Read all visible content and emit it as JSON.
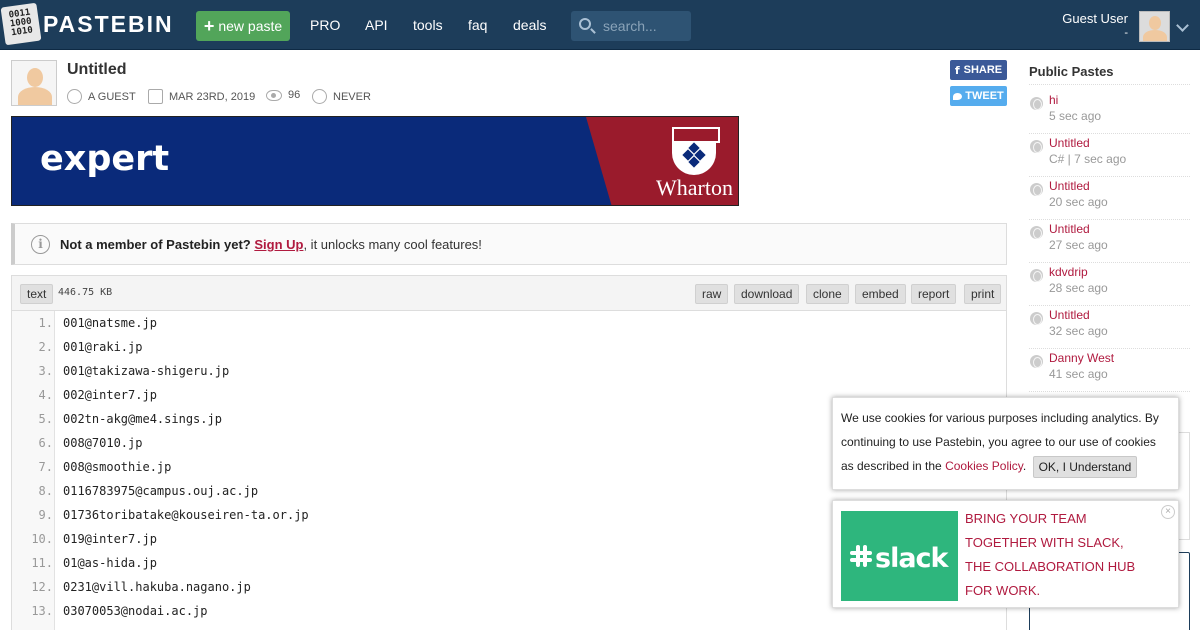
{
  "header": {
    "logo_glyphs": [
      "0011",
      "1000",
      "1010"
    ],
    "brand": "PASTEBIN",
    "new_paste": "new paste",
    "nav": [
      "PRO",
      "API",
      "tools",
      "faq",
      "deals"
    ],
    "search_placeholder": "search...",
    "user_name": "Guest User",
    "user_sub": "-"
  },
  "paste": {
    "title": "Untitled",
    "author": "A GUEST",
    "date": "MAR 23RD, 2019",
    "views": "96",
    "expires": "NEVER",
    "share_label": "SHARE",
    "tweet_label": "TWEET"
  },
  "ad": {
    "headline": "expert",
    "brand": "Wharton"
  },
  "notice": {
    "lead": "Not a member of Pastebin yet?",
    "link": "Sign Up",
    "rest": ", it unlocks many cool features!"
  },
  "codebox": {
    "syntax": "text",
    "size": "446.75 KB",
    "actions": [
      "raw",
      "download",
      "clone",
      "embed",
      "report",
      "print"
    ],
    "lines": [
      {
        "num": "1.",
        "text": "001@natsme.jp"
      },
      {
        "num": "2.",
        "text": "001@raki.jp"
      },
      {
        "num": "3.",
        "text": "001@takizawa-shigeru.jp"
      },
      {
        "num": "4.",
        "text": "002@inter7.jp"
      },
      {
        "num": "5.",
        "text": "002tn-akg@me4.sings.jp"
      },
      {
        "num": "6.",
        "text": "008@7010.jp"
      },
      {
        "num": "7.",
        "text": "008@smoothie.jp"
      },
      {
        "num": "8.",
        "text": "0116783975@campus.ouj.ac.jp"
      },
      {
        "num": "9.",
        "text": "01736toribatake@kouseiren-ta.or.jp"
      },
      {
        "num": "10.",
        "text": "019@inter7.jp"
      },
      {
        "num": "11.",
        "text": "01@as-hida.jp"
      },
      {
        "num": "12.",
        "text": "0231@vill.hakuba.nagano.jp"
      },
      {
        "num": "13.",
        "text": "03070053@nodai.ac.jp"
      }
    ]
  },
  "sidebar": {
    "title": "Public Pastes",
    "items": [
      {
        "title": "hi",
        "sub": "5 sec ago"
      },
      {
        "title": "Untitled",
        "sub": "C# | 7 sec ago"
      },
      {
        "title": "Untitled",
        "sub": "20 sec ago"
      },
      {
        "title": "Untitled",
        "sub": "27 sec ago"
      },
      {
        "title": "kdvdrip",
        "sub": "28 sec ago"
      },
      {
        "title": "Untitled",
        "sub": "32 sec ago"
      },
      {
        "title": "Danny West",
        "sub": "41 sec ago"
      }
    ]
  },
  "cookie": {
    "text": "We use cookies for various purposes including analytics. By continuing to use Pastebin, you agree to our use of cookies as described in the",
    "link": "Cookies Policy",
    "period": ".",
    "ok": "OK, I Understand"
  },
  "slack_ad": {
    "logo": "slack",
    "message": "BRING YOUR TEAM TOGETHER WITH SLACK, THE COLLABORATION HUB FOR WORK."
  },
  "colors": {
    "header_bg": "#1d3d5a",
    "new_paste_bg": "#52a55a",
    "accent_link": "#b01a3f",
    "facebook": "#3b5998",
    "twitter": "#55acee",
    "slack_green": "#2eb67d"
  }
}
